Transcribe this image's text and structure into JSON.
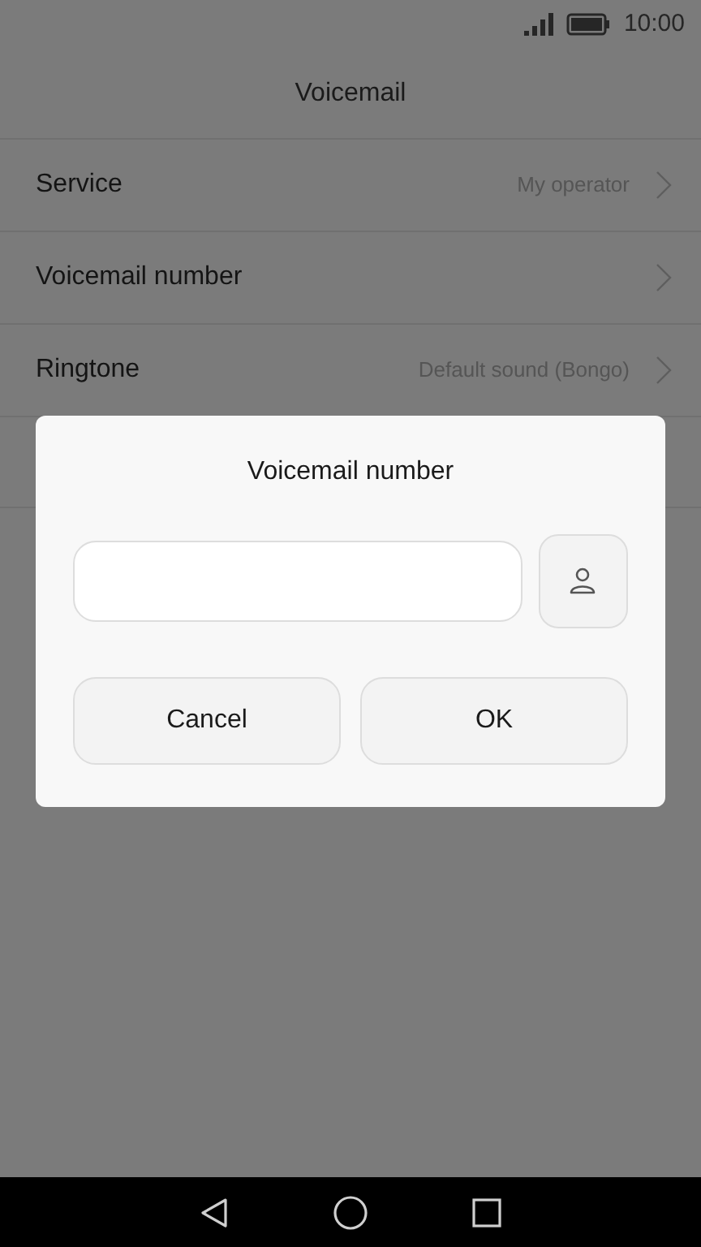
{
  "status_bar": {
    "time": "10:00"
  },
  "header": {
    "title": "Voicemail"
  },
  "settings": [
    {
      "label": "Service",
      "value": "My operator"
    },
    {
      "label": "Voicemail number"
    },
    {
      "label": "Ringtone",
      "value": "Default sound (Bongo)"
    }
  ],
  "dialog": {
    "title": "Voicemail number",
    "buttons": [
      "Cancel",
      "OK"
    ]
  }
}
